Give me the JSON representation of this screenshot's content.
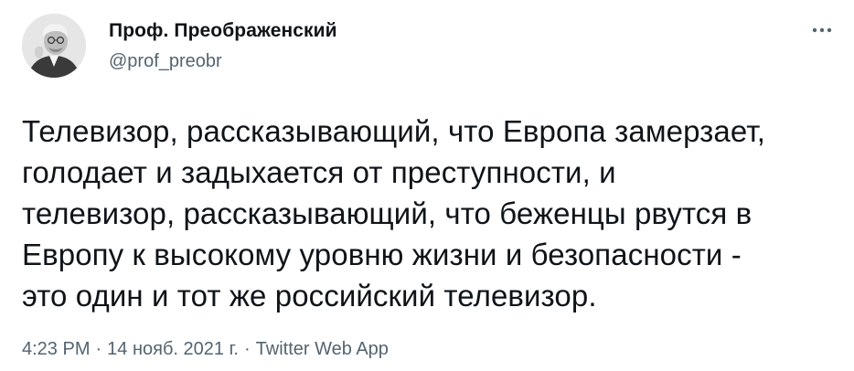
{
  "author": {
    "display_name": "Проф. Преображенский",
    "handle": "@prof_preobr",
    "avatar_icon": "profile-photo"
  },
  "more_icon": "ellipsis-icon",
  "tweet": {
    "text": "Телевизор, рассказывающий, что Европа замерзает,\nголодает и задыхается от преступности, и\nтелевизор, рассказывающий, что беженцы рвутся в\nЕвропу к высокому уровню жизни и безопасности -\nэто один и тот же российский телевизор."
  },
  "meta": {
    "time": "4:23 PM",
    "separator": "·",
    "date": "14 нояб. 2021 г.",
    "source": "Twitter Web App"
  },
  "colors": {
    "text_primary": "#0f1419",
    "text_secondary": "#536471",
    "background": "#ffffff"
  }
}
